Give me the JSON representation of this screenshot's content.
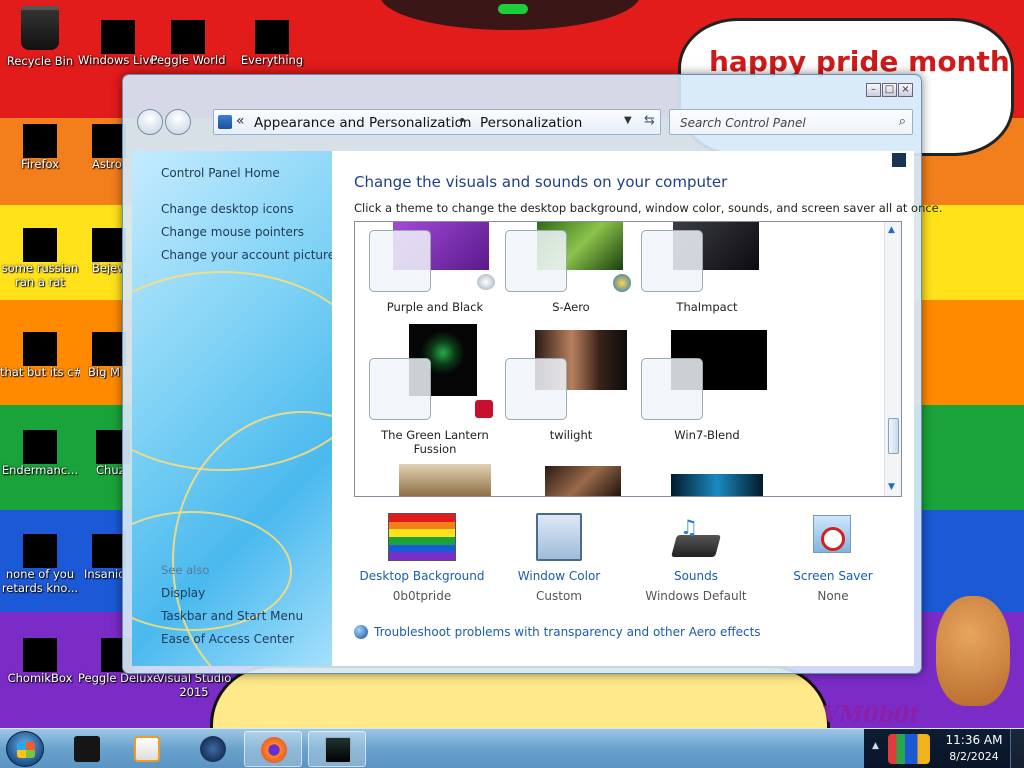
{
  "desktop": {
    "banner_text": "happy pride month",
    "watermark": "VM0b0t",
    "icons": [
      {
        "label": "Recycle Bin"
      },
      {
        "label": "Windows Live Mai"
      },
      {
        "label": "Peggle World"
      },
      {
        "label": "Everything"
      },
      {
        "label": "Firefox"
      },
      {
        "label": "Astro Delu"
      },
      {
        "label": "some russian ran a rat"
      },
      {
        "label": "Bejew Delu"
      },
      {
        "label": "that but its c#"
      },
      {
        "label": "Big M Delu"
      },
      {
        "label": "Endermanc..."
      },
      {
        "label": "Chuz Delu"
      },
      {
        "label": "none of you retards kno..."
      },
      {
        "label": "Insaniq Delu"
      },
      {
        "label": "ChomikBox"
      },
      {
        "label": "Peggle Deluxe"
      },
      {
        "label": "Visual Studio 2015"
      }
    ]
  },
  "window": {
    "breadcrumb": [
      "Appearance and Personalization",
      "Personalization"
    ],
    "search_placeholder": "Search Control Panel",
    "left_nav": {
      "home": "Control Panel Home",
      "links": [
        "Change desktop icons",
        "Change mouse pointers",
        "Change your account picture"
      ],
      "see_also_title": "See also",
      "see_also": [
        "Display",
        "Taskbar and Start Menu",
        "Ease of Access Center"
      ]
    },
    "heading": "Change the visuals and sounds on your computer",
    "subheading": "Click a theme to change the desktop background, window color, sounds, and screen saver all at once.",
    "themes": [
      {
        "name": "Purple and Black"
      },
      {
        "name": "S-Aero"
      },
      {
        "name": "ThaImpact"
      },
      {
        "name": "The Green Lantern Fussion"
      },
      {
        "name": "twilight"
      },
      {
        "name": "Win7-Blend"
      }
    ],
    "settings": [
      {
        "label": "Desktop Background",
        "value": "0b0tpride"
      },
      {
        "label": "Window Color",
        "value": "Custom"
      },
      {
        "label": "Sounds",
        "value": "Windows Default"
      },
      {
        "label": "Screen Saver",
        "value": "None"
      }
    ],
    "troubleshoot": "Troubleshoot problems with transparency and other Aero effects"
  },
  "taskbar": {
    "time": "11:36 AM",
    "date": "8/2/2024"
  },
  "colors": {
    "link": "#1a5cb0",
    "heading": "#1c3f8c",
    "banner": "#d01a1a"
  }
}
